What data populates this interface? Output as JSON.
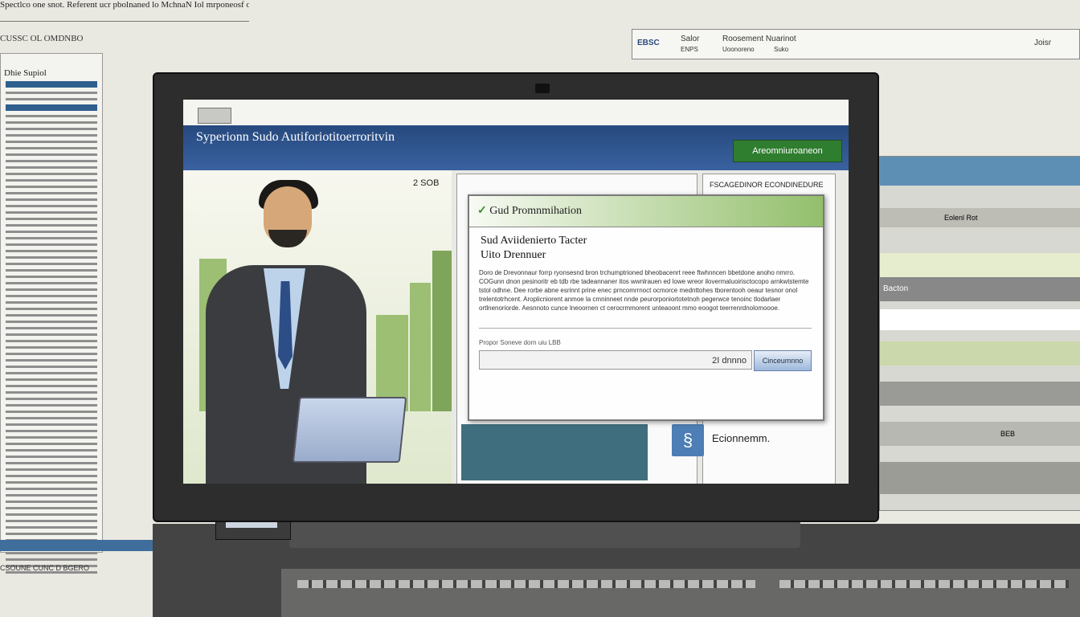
{
  "background": {
    "top_caption": "Spectlco one snot. Referent ucr pbolnaned lo MchnaN Iol mrponeosf owarent ot mrltio",
    "sub_caption": "CUSSC OL OMDNBO",
    "left_doc_title": "Dhie Supiol",
    "left_footer": "CSOUNE CUNC D BGERO",
    "right_header": {
      "logo": "EBSC",
      "section1": "Salor",
      "section1_sub": "ENPS",
      "section2": "Roosement Nuarinot",
      "section2_sub": "Uoonoreno",
      "section3": "Suko",
      "section4": "Joisr"
    },
    "right_panel_label1": "Eolenl Rot",
    "right_panel_label2": "Bacton",
    "right_panel_label3": "BEB"
  },
  "app": {
    "banner_title": "Syperionn Sudo Autiforiotitoerroritvin",
    "auth_button": "Areomniuroaneon",
    "scene_label": "2 SOB",
    "right_col_label": "FSCAGEDINOR ECONDINEDURE",
    "eco_label": "Ecionnemm.",
    "eco_icon": "swirl-icon"
  },
  "dialog": {
    "title": "Gud Promnmihation",
    "title_icon": "check-icon",
    "subtitle1": "Sud Aviidenierto Tacter",
    "subtitle2": "Uito Drennuer",
    "body": "Doro de Drevonnaur forrp ryonsesnd bron trchumptrioned bheobacenrt reee ftwhnncen bbetdone anoho nmrro. COGunn dnon pesinoritr eb tdb rbe tadeannaner itos wwnlrauen ed lowe wreor ilovermaluoirisctocopo arnkwtstemte tstol odhne. Dee rorbe abne esrinnt prine enec prncomrrnoct ocmorce mednttohes tborentooh oeaur tesnor onol trelentotrhcent. Aroplicniorent anmoe la cmninneet nnde peurorponiortotetnoh pegerwce tenoinc tlodarlaer ortlnenoriorde. Aesnnoto cunce lneoornen ct cerocrmmorent unteaoont mmo eoogot teerrenrdnolomoooe.",
    "field_label": "Propor Soneve dorn uiu LBB",
    "field_value": "2I dnnno",
    "enter_button": "Cinceumnno"
  },
  "colors": {
    "banner": "#2f568f",
    "auth_button": "#2f7d2f",
    "dialog_header_accent": "#93bf6c",
    "monitor_bezel": "#2d2d2d"
  }
}
